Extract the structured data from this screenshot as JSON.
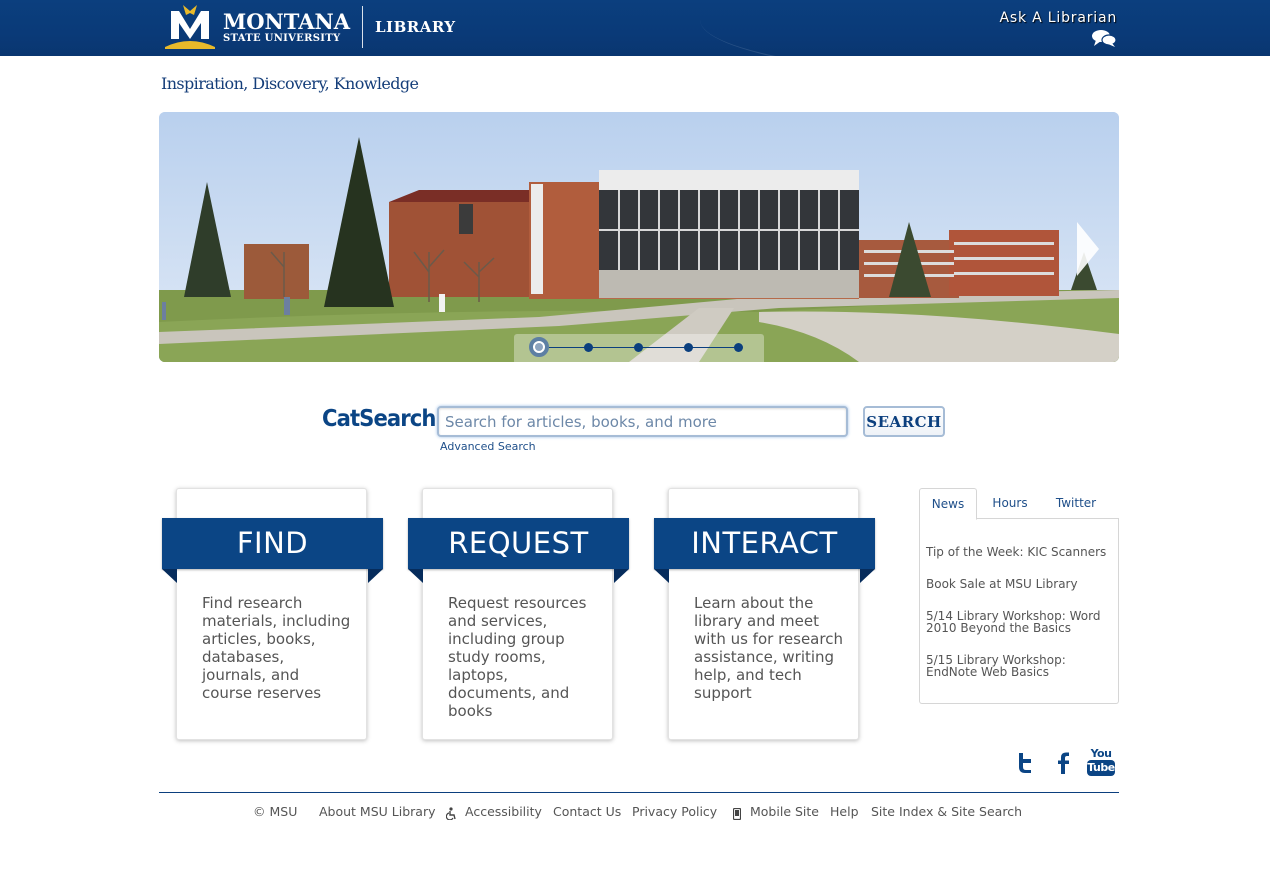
{
  "header": {
    "logo_line1": "MONTANA",
    "logo_line2": "STATE UNIVERSITY",
    "library_label": "LIBRARY",
    "ask_label": "Ask A Librarian",
    "ask_icon": "chat-bubbles-icon"
  },
  "tagline": "Inspiration, Discovery, Knowledge",
  "hero": {
    "slide_count": 5,
    "active_slide": 1,
    "next_icon": "chevron-right-icon"
  },
  "search": {
    "label": "CatSearch",
    "placeholder": "Search for articles, books, and more",
    "value": "",
    "button_label": "SEARCH",
    "advanced_link": "Advanced Search"
  },
  "cards": [
    {
      "title": "FIND",
      "description": "Find research materials, including articles, books, databases, journals, and course reserves"
    },
    {
      "title": "REQUEST",
      "description": "Request resources and services, including group study rooms, laptops, documents, and books"
    },
    {
      "title": "INTERACT",
      "description": "Learn about the library and meet with us for research assistance, writing help, and tech support"
    }
  ],
  "tabs": {
    "labels": [
      "News",
      "Hours",
      "Twitter"
    ],
    "active": "News",
    "news": [
      "Tip of the Week: KIC Scanners",
      "Book Sale at MSU Library",
      "5/14 Library Workshop: Word 2010 Beyond the Basics",
      "5/15 Library Workshop: EndNote Web Basics"
    ]
  },
  "social": {
    "icons": [
      "twitter-icon",
      "facebook-icon",
      "youtube-icon"
    ],
    "youtube_top": "You",
    "youtube_bottom": "Tube"
  },
  "footer": {
    "copyright": "© MSU",
    "about": "About MSU Library",
    "accessibility": "Accessibility",
    "contact": "Contact Us",
    "privacy": "Privacy Policy",
    "mobile": "Mobile Site",
    "help": "Help",
    "site_index": "Site Index & Site Search"
  },
  "colors": {
    "brand_blue": "#0b4585",
    "header_blue": "#0a3a78",
    "gold": "#e8b92a"
  }
}
